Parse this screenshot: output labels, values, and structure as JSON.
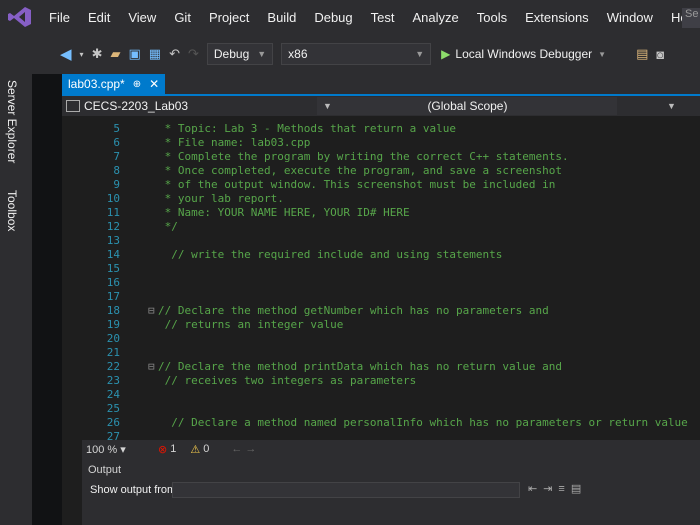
{
  "menubar": {
    "items": [
      "File",
      "Edit",
      "View",
      "Git",
      "Project",
      "Build",
      "Debug",
      "Test",
      "Analyze",
      "Tools",
      "Extensions",
      "Window",
      "Help"
    ],
    "search_placeholder": "Se"
  },
  "toolbar": {
    "configuration": "Debug",
    "platform": "x86",
    "debugger": "Local Windows Debugger"
  },
  "siderail": {
    "items": [
      "Server Explorer",
      "Toolbox"
    ]
  },
  "editor": {
    "tab": {
      "label": "lab03.cpp*",
      "pin": "⊕",
      "close": "✕"
    },
    "navbar": {
      "project": "CECS-2203_Lab03",
      "scope": "(Global Scope)"
    },
    "lines": [
      {
        "n": "5",
        "mark": "",
        "text": " * Topic: Lab 3 - Methods that return a value"
      },
      {
        "n": "6",
        "mark": "",
        "text": " * File name: lab03.cpp"
      },
      {
        "n": "7",
        "mark": "",
        "text": " * Complete the program by writing the correct C++ statements."
      },
      {
        "n": "8",
        "mark": "",
        "text": " * Once completed, execute the program, and save a screenshot"
      },
      {
        "n": "9",
        "mark": "",
        "text": " * of the output window. This screenshot must be included in"
      },
      {
        "n": "10",
        "mark": "",
        "text": " * your lab report."
      },
      {
        "n": "11",
        "mark": "",
        "text": " * Name: YOUR NAME HERE, YOUR ID# HERE"
      },
      {
        "n": "12",
        "mark": "",
        "text": " */"
      },
      {
        "n": "13",
        "mark": "",
        "text": ""
      },
      {
        "n": "14",
        "mark": "",
        "text": "  // write the required include and using statements"
      },
      {
        "n": "15",
        "mark": "",
        "text": ""
      },
      {
        "n": "16",
        "mark": "",
        "text": ""
      },
      {
        "n": "17",
        "mark": "",
        "text": ""
      },
      {
        "n": "18",
        "mark": "⊟",
        "text": "// Declare the method getNumber which has no parameters and"
      },
      {
        "n": "19",
        "mark": "",
        "text": " // returns an integer value"
      },
      {
        "n": "20",
        "mark": "",
        "text": ""
      },
      {
        "n": "21",
        "mark": "",
        "text": ""
      },
      {
        "n": "22",
        "mark": "⊟",
        "text": "// Declare the method printData which has no return value and"
      },
      {
        "n": "23",
        "mark": "",
        "text": " // receives two integers as parameters"
      },
      {
        "n": "24",
        "mark": "",
        "text": ""
      },
      {
        "n": "25",
        "mark": "",
        "text": ""
      },
      {
        "n": "26",
        "mark": "",
        "text": "  // Declare a method named personalInfo which has no parameters or return value"
      },
      {
        "n": "27",
        "mark": "",
        "text": ""
      }
    ]
  },
  "statusbar": {
    "zoom": "100 %",
    "errors": "1",
    "warnings": "0"
  },
  "output": {
    "title": "Output",
    "show_from": "Show output from:"
  },
  "colors": {
    "accent": "#007acc",
    "comment": "#57a64a",
    "line_number": "#2b91af",
    "chrome": "#2d2d30",
    "editor_bg": "#1e1e1e"
  }
}
